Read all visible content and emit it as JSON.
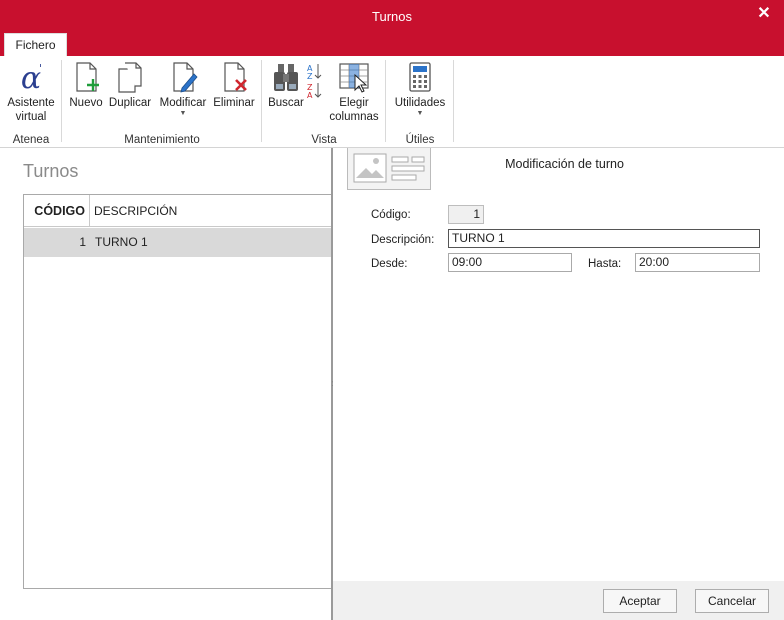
{
  "window": {
    "title": "Turnos"
  },
  "menu": {
    "tab_file": "Fichero"
  },
  "ribbon": {
    "groups": {
      "atenea": "Atenea",
      "mantenimiento": "Mantenimiento",
      "vista": "Vista",
      "utiles": "Útiles"
    },
    "buttons": {
      "asistente_line1": "Asistente",
      "asistente_line2": "virtual",
      "nuevo": "Nuevo",
      "duplicar": "Duplicar",
      "modificar": "Modificar",
      "eliminar": "Eliminar",
      "buscar": "Buscar",
      "elegir_line1": "Elegir",
      "elegir_line2": "columnas",
      "utilidades": "Utilidades"
    },
    "icons": {
      "asistente": "alpha-icon",
      "nuevo": "new-document-icon",
      "duplicar": "duplicate-icon",
      "modificar": "edit-document-icon",
      "eliminar": "delete-document-icon",
      "buscar": "binoculars-icon",
      "sort": "sort-az-icon",
      "elegir": "choose-columns-icon",
      "utilidades": "calculator-icon"
    }
  },
  "list": {
    "title": "Turnos",
    "columns": {
      "code": "CÓDIGO",
      "description": "DESCRIPCIÓN"
    },
    "rows": [
      {
        "code": "1",
        "description": "TURNO 1"
      }
    ]
  },
  "form": {
    "title": "Modificación de turno",
    "code_label": "Código:",
    "code_value": "1",
    "description_label": "Descripción:",
    "description_value": "TURNO 1",
    "from_label": "Desde:",
    "from_value": "09:00",
    "to_label": "Hasta:",
    "to_value": "20:00"
  },
  "footer": {
    "accept": "Aceptar",
    "cancel": "Cancelar"
  },
  "colors": {
    "brand": "#c8102e",
    "accent_green": "#1f9d3a",
    "accent_red": "#d0262e",
    "accent_blue": "#2b73c9"
  }
}
